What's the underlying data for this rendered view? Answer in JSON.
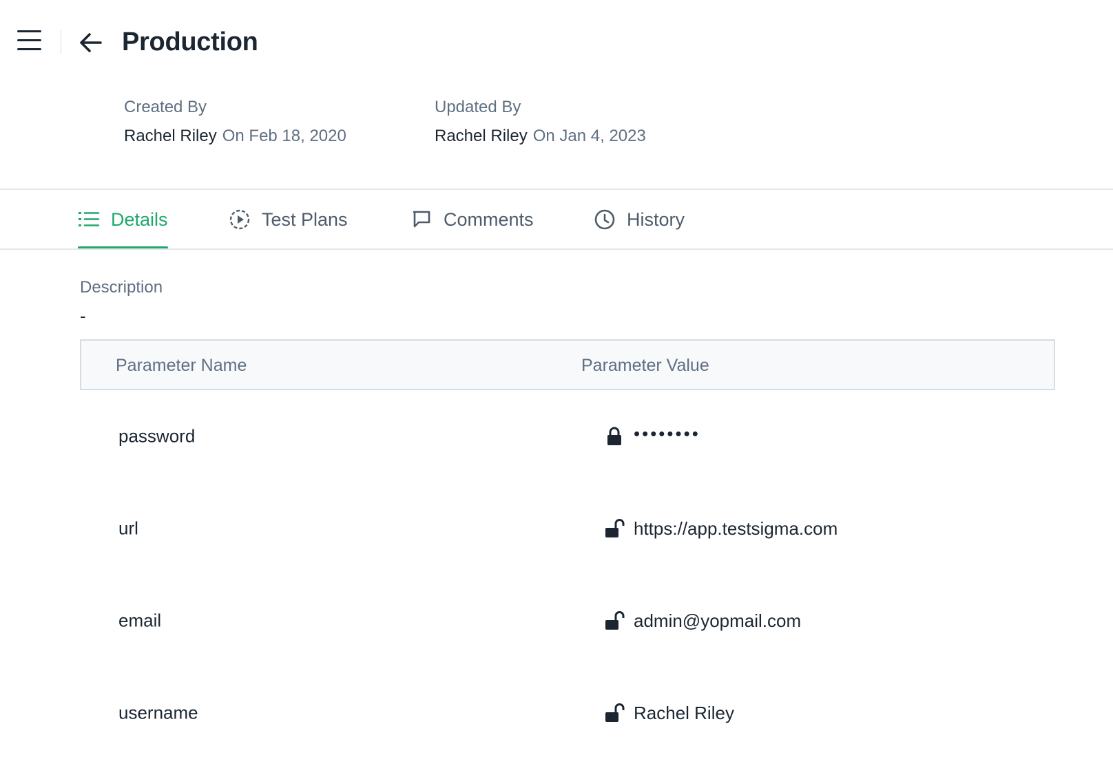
{
  "header": {
    "title": "Production",
    "menu_icon": "hamburger-menu-icon",
    "back_icon": "arrow-left-icon"
  },
  "meta": {
    "created": {
      "label": "Created By",
      "name": "Rachel Riley",
      "date": "On Feb 18, 2020"
    },
    "updated": {
      "label": "Updated By",
      "name": "Rachel Riley",
      "date": "On Jan 4, 2023"
    }
  },
  "tabs": [
    {
      "label": "Details",
      "icon": "list-icon",
      "active": true
    },
    {
      "label": "Test Plans",
      "icon": "play-circle-icon",
      "active": false
    },
    {
      "label": "Comments",
      "icon": "comment-icon",
      "active": false
    },
    {
      "label": "History",
      "icon": "clock-icon",
      "active": false
    }
  ],
  "description": {
    "label": "Description",
    "value": "-"
  },
  "table": {
    "columns": [
      "Parameter Name",
      "Parameter Value"
    ],
    "rows": [
      {
        "name": "password",
        "value": "••••••••",
        "locked": true
      },
      {
        "name": "url",
        "value": "https://app.testsigma.com",
        "locked": false
      },
      {
        "name": "email",
        "value": "admin@yopmail.com",
        "locked": false
      },
      {
        "name": "username",
        "value": "Rachel Riley",
        "locked": false
      }
    ]
  },
  "colors": {
    "accent": "#1fa86c",
    "text_primary": "#1b2631",
    "text_secondary": "#5f6f82",
    "border": "#d5dce4",
    "header_bg": "#f7f9fb"
  }
}
